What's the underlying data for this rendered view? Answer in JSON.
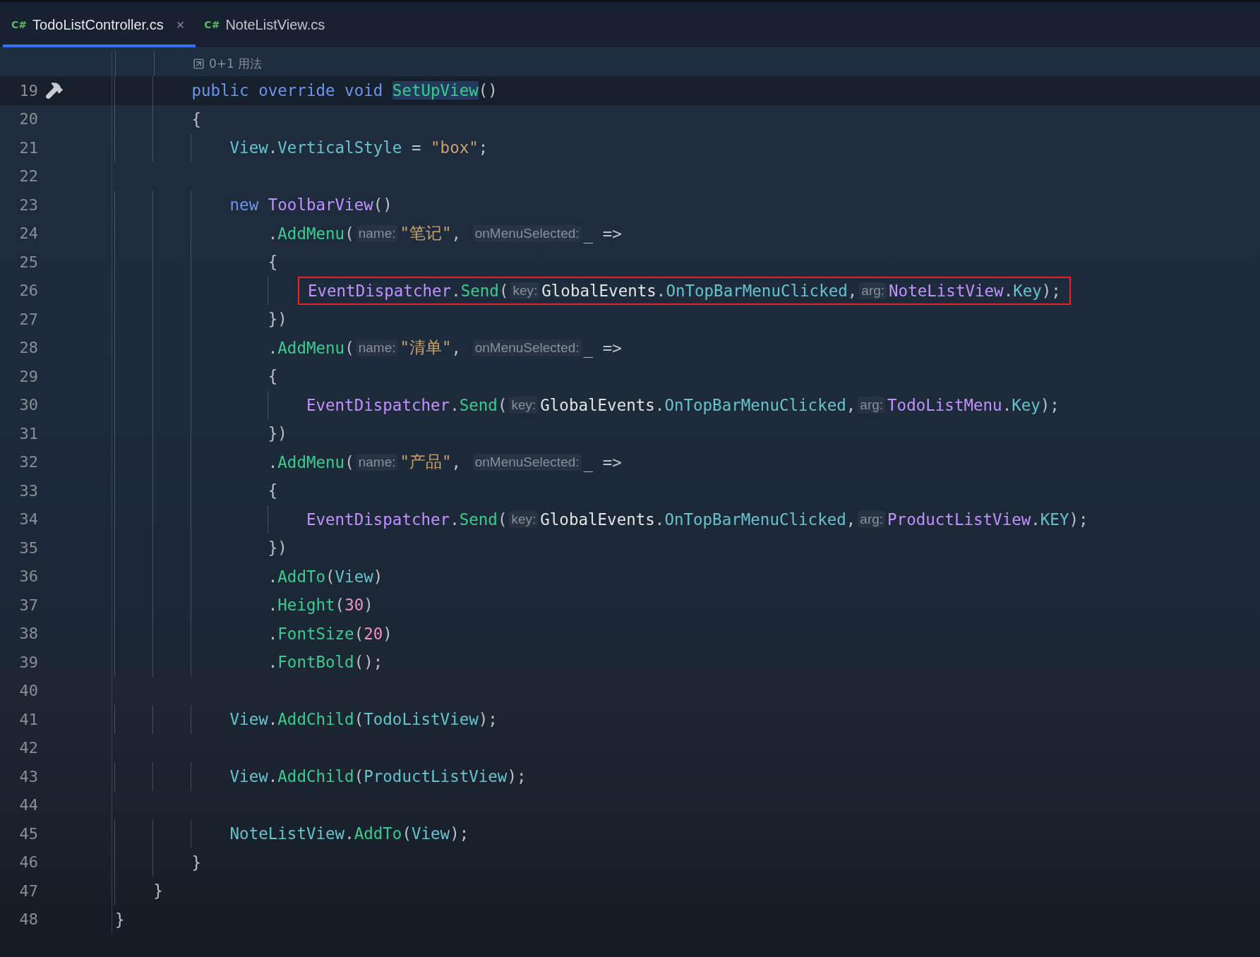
{
  "tabs": [
    {
      "icon_text": "C#",
      "label": "TodoListController.cs",
      "selected": true,
      "close": "×"
    },
    {
      "icon_text": "C#",
      "label": "NoteListView.cs",
      "selected": false
    }
  ],
  "usage_hint": {
    "text": "0+1 用法"
  },
  "lines": [
    {
      "number": "19",
      "current": true,
      "tokens": [
        {
          "kind": "kw",
          "text": "        public override void "
        },
        {
          "kind": "fn",
          "text": "SetUpView",
          "highlighted": true
        },
        {
          "kind": "p",
          "text": "()"
        }
      ]
    },
    {
      "number": "20",
      "tokens": [
        {
          "kind": "p",
          "text": "        {"
        }
      ]
    },
    {
      "number": "21",
      "tokens": [
        {
          "kind": "prop",
          "text": "            View"
        },
        {
          "kind": "p",
          "text": "."
        },
        {
          "kind": "prop",
          "text": "VerticalStyle"
        },
        {
          "kind": "p",
          "text": " = "
        },
        {
          "kind": "str",
          "text": "\"box\""
        },
        {
          "kind": "p",
          "text": ";"
        }
      ]
    },
    {
      "number": "22"
    },
    {
      "number": "23",
      "tokens": [
        {
          "kind": "kw",
          "text": "            new "
        },
        {
          "kind": "type",
          "text": "ToolbarView"
        },
        {
          "kind": "p",
          "text": "()"
        }
      ]
    },
    {
      "number": "24",
      "tokens": [
        {
          "kind": "p",
          "text": "                ."
        },
        {
          "kind": "fn",
          "text": "AddMenu"
        },
        {
          "kind": "p",
          "text": "("
        },
        {
          "kind": "hint",
          "text": "name:"
        },
        {
          "kind": "str",
          "text": "\"笔记\""
        },
        {
          "kind": "p",
          "text": ", "
        },
        {
          "kind": "hint",
          "text": "onMenuSelected:"
        },
        {
          "kind": "p",
          "text": "_ =>"
        }
      ]
    },
    {
      "number": "25",
      "tokens": [
        {
          "kind": "p",
          "text": "                {"
        }
      ]
    },
    {
      "number": "26",
      "boxed": true,
      "tokens": [
        {
          "kind": "type",
          "text": "                    EventDispatcher"
        },
        {
          "kind": "p",
          "text": "."
        },
        {
          "kind": "fn",
          "text": "Send"
        },
        {
          "kind": "p",
          "text": "("
        },
        {
          "kind": "hint",
          "text": "key:"
        },
        {
          "kind": "id",
          "text": "GlobalEvents"
        },
        {
          "kind": "p",
          "text": "."
        },
        {
          "kind": "prop",
          "text": "OnTopBarMenuClicked"
        },
        {
          "kind": "p",
          "text": ","
        },
        {
          "kind": "hint",
          "text": "arg:"
        },
        {
          "kind": "type",
          "text": "NoteListView"
        },
        {
          "kind": "p",
          "text": "."
        },
        {
          "kind": "prop",
          "text": "Key"
        },
        {
          "kind": "p",
          "text": ");"
        }
      ]
    },
    {
      "number": "27",
      "tokens": [
        {
          "kind": "p",
          "text": "                })"
        }
      ]
    },
    {
      "number": "28",
      "tokens": [
        {
          "kind": "p",
          "text": "                ."
        },
        {
          "kind": "fn",
          "text": "AddMenu"
        },
        {
          "kind": "p",
          "text": "("
        },
        {
          "kind": "hint",
          "text": "name:"
        },
        {
          "kind": "str",
          "text": "\"清单\""
        },
        {
          "kind": "p",
          "text": ", "
        },
        {
          "kind": "hint",
          "text": "onMenuSelected:"
        },
        {
          "kind": "p",
          "text": "_ =>"
        }
      ]
    },
    {
      "number": "29",
      "tokens": [
        {
          "kind": "p",
          "text": "                {"
        }
      ]
    },
    {
      "number": "30",
      "tokens": [
        {
          "kind": "type",
          "text": "                    EventDispatcher"
        },
        {
          "kind": "p",
          "text": "."
        },
        {
          "kind": "fn",
          "text": "Send"
        },
        {
          "kind": "p",
          "text": "("
        },
        {
          "kind": "hint",
          "text": "key:"
        },
        {
          "kind": "id",
          "text": "GlobalEvents"
        },
        {
          "kind": "p",
          "text": "."
        },
        {
          "kind": "prop",
          "text": "OnTopBarMenuClicked"
        },
        {
          "kind": "p",
          "text": ","
        },
        {
          "kind": "hint",
          "text": "arg:"
        },
        {
          "kind": "type",
          "text": "TodoListMenu"
        },
        {
          "kind": "p",
          "text": "."
        },
        {
          "kind": "prop",
          "text": "Key"
        },
        {
          "kind": "p",
          "text": ");"
        }
      ]
    },
    {
      "number": "31",
      "tokens": [
        {
          "kind": "p",
          "text": "                })"
        }
      ]
    },
    {
      "number": "32",
      "tokens": [
        {
          "kind": "p",
          "text": "                ."
        },
        {
          "kind": "fn",
          "text": "AddMenu"
        },
        {
          "kind": "p",
          "text": "("
        },
        {
          "kind": "hint",
          "text": "name:"
        },
        {
          "kind": "str",
          "text": "\"产品\""
        },
        {
          "kind": "p",
          "text": ", "
        },
        {
          "kind": "hint",
          "text": "onMenuSelected:"
        },
        {
          "kind": "p",
          "text": "_ =>"
        }
      ]
    },
    {
      "number": "33",
      "tokens": [
        {
          "kind": "p",
          "text": "                {"
        }
      ]
    },
    {
      "number": "34",
      "tokens": [
        {
          "kind": "type",
          "text": "                    EventDispatcher"
        },
        {
          "kind": "p",
          "text": "."
        },
        {
          "kind": "fn",
          "text": "Send"
        },
        {
          "kind": "p",
          "text": "("
        },
        {
          "kind": "hint",
          "text": "key:"
        },
        {
          "kind": "id",
          "text": "GlobalEvents"
        },
        {
          "kind": "p",
          "text": "."
        },
        {
          "kind": "prop",
          "text": "OnTopBarMenuClicked"
        },
        {
          "kind": "p",
          "text": ","
        },
        {
          "kind": "hint",
          "text": "arg:"
        },
        {
          "kind": "type",
          "text": "ProductListView"
        },
        {
          "kind": "p",
          "text": "."
        },
        {
          "kind": "prop",
          "text": "KEY"
        },
        {
          "kind": "p",
          "text": ");"
        }
      ]
    },
    {
      "number": "35",
      "tokens": [
        {
          "kind": "p",
          "text": "                })"
        }
      ]
    },
    {
      "number": "36",
      "tokens": [
        {
          "kind": "p",
          "text": "                ."
        },
        {
          "kind": "fn",
          "text": "AddTo"
        },
        {
          "kind": "p",
          "text": "("
        },
        {
          "kind": "prop",
          "text": "View"
        },
        {
          "kind": "p",
          "text": ")"
        }
      ]
    },
    {
      "number": "37",
      "tokens": [
        {
          "kind": "p",
          "text": "                ."
        },
        {
          "kind": "fn",
          "text": "Height"
        },
        {
          "kind": "p",
          "text": "("
        },
        {
          "kind": "num",
          "text": "30"
        },
        {
          "kind": "p",
          "text": ")"
        }
      ]
    },
    {
      "number": "38",
      "tokens": [
        {
          "kind": "p",
          "text": "                ."
        },
        {
          "kind": "fn",
          "text": "FontSize"
        },
        {
          "kind": "p",
          "text": "("
        },
        {
          "kind": "num",
          "text": "20"
        },
        {
          "kind": "p",
          "text": ")"
        }
      ]
    },
    {
      "number": "39",
      "tokens": [
        {
          "kind": "p",
          "text": "                ."
        },
        {
          "kind": "fn",
          "text": "FontBold"
        },
        {
          "kind": "p",
          "text": "();"
        }
      ]
    },
    {
      "number": "40"
    },
    {
      "number": "41",
      "tokens": [
        {
          "kind": "prop",
          "text": "            View"
        },
        {
          "kind": "p",
          "text": "."
        },
        {
          "kind": "fn",
          "text": "AddChild"
        },
        {
          "kind": "p",
          "text": "("
        },
        {
          "kind": "prop",
          "text": "TodoListView"
        },
        {
          "kind": "p",
          "text": ");"
        }
      ]
    },
    {
      "number": "42"
    },
    {
      "number": "43",
      "tokens": [
        {
          "kind": "prop",
          "text": "            View"
        },
        {
          "kind": "p",
          "text": "."
        },
        {
          "kind": "fn",
          "text": "AddChild"
        },
        {
          "kind": "p",
          "text": "("
        },
        {
          "kind": "prop",
          "text": "ProductListView"
        },
        {
          "kind": "p",
          "text": ");"
        }
      ]
    },
    {
      "number": "44"
    },
    {
      "number": "45",
      "tokens": [
        {
          "kind": "prop",
          "text": "            NoteListView"
        },
        {
          "kind": "p",
          "text": "."
        },
        {
          "kind": "fn",
          "text": "AddTo"
        },
        {
          "kind": "p",
          "text": "("
        },
        {
          "kind": "prop",
          "text": "View"
        },
        {
          "kind": "p",
          "text": ");"
        }
      ]
    },
    {
      "number": "46",
      "tokens": [
        {
          "kind": "p",
          "text": "        }"
        }
      ]
    },
    {
      "number": "47",
      "tokens": [
        {
          "kind": "p",
          "text": "    }"
        }
      ]
    },
    {
      "number": "48",
      "tokens": [
        {
          "kind": "p",
          "text": "}"
        }
      ]
    }
  ]
}
